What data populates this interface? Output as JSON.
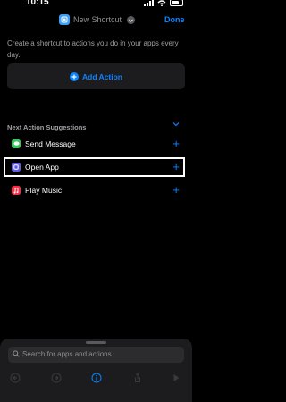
{
  "status": {
    "time": "10:15"
  },
  "nav": {
    "title": "New Shortcut",
    "done_label": "Done",
    "accent": "#0a84ff"
  },
  "description": "Create a shortcut to actions you do in your apps every day.",
  "add_action": {
    "label": "Add Action"
  },
  "suggestions": {
    "header": "Next Action Suggestions",
    "items": [
      {
        "label": "Send Message",
        "icon": "messages-icon",
        "color": "#34c759"
      },
      {
        "label": "Open App",
        "icon": "open-app-icon",
        "color": "#5e5ce6"
      },
      {
        "label": "Play Music",
        "icon": "music-icon",
        "color": "#fa2d48"
      }
    ]
  },
  "search": {
    "placeholder": "Search for apps and actions"
  },
  "toolbar": {
    "icons": [
      "undo-icon",
      "redo-icon",
      "info-icon",
      "share-icon",
      "play-icon"
    ]
  }
}
